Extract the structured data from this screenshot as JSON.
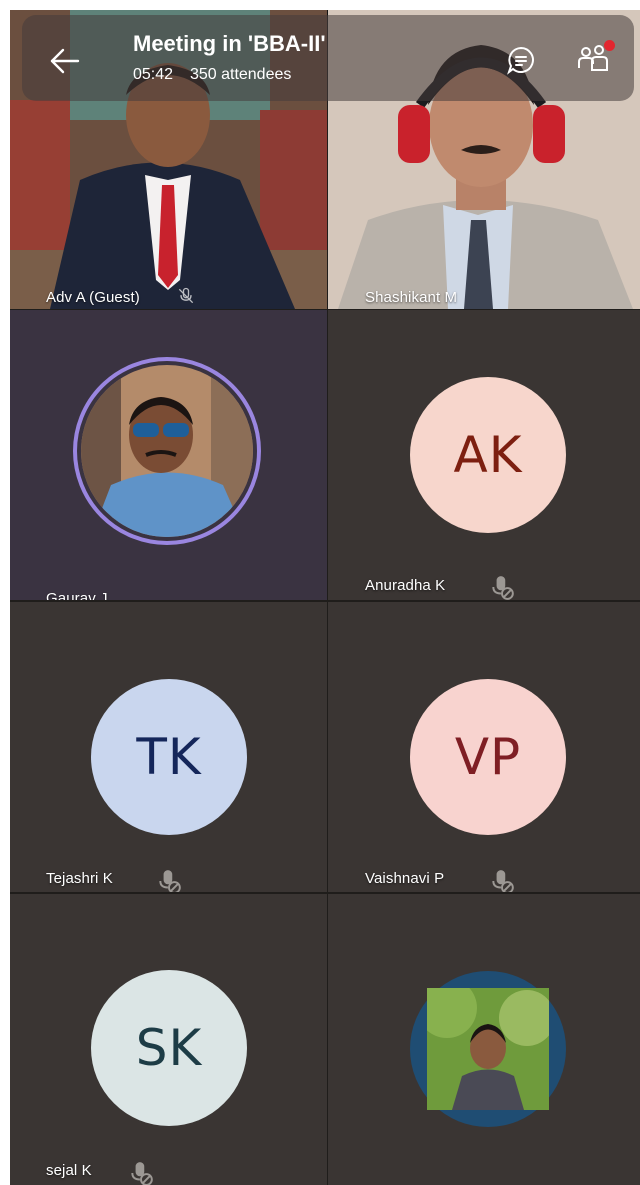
{
  "meeting": {
    "title": "Meeting in 'BBA-II'",
    "duration": "05:42",
    "attendees": "350 attendees"
  },
  "participants": [
    {
      "name": "Adv A (Guest)"
    },
    {
      "name": "Shashikant M"
    },
    {
      "name": "Gaurav J"
    },
    {
      "name": "Anuradha K",
      "initials": "AK"
    },
    {
      "name": "Tejashri K",
      "initials": "TK"
    },
    {
      "name": "Vaishnavi P",
      "initials": "VP"
    },
    {
      "name": "sejal K",
      "initials": "SK"
    },
    {
      "name": ""
    }
  ],
  "icons": [
    "back-arrow-icon",
    "chat-icon",
    "people-icon",
    "mic-off-icon"
  ],
  "colors": {
    "tile_bg": "#3a3533",
    "active_tile_bg": "#3a3341",
    "active_ring": "#9a86e0",
    "notification_dot": "#e3262f",
    "ak_bg": "#f7d6cc",
    "ak_fg": "#7d1f10",
    "tk_bg": "#c9d6ee",
    "tk_fg": "#14265a",
    "vp_bg": "#f8d3cf",
    "vp_fg": "#7f1e24",
    "sk_bg": "#dbe5e5",
    "sk_fg": "#1d3c46"
  }
}
